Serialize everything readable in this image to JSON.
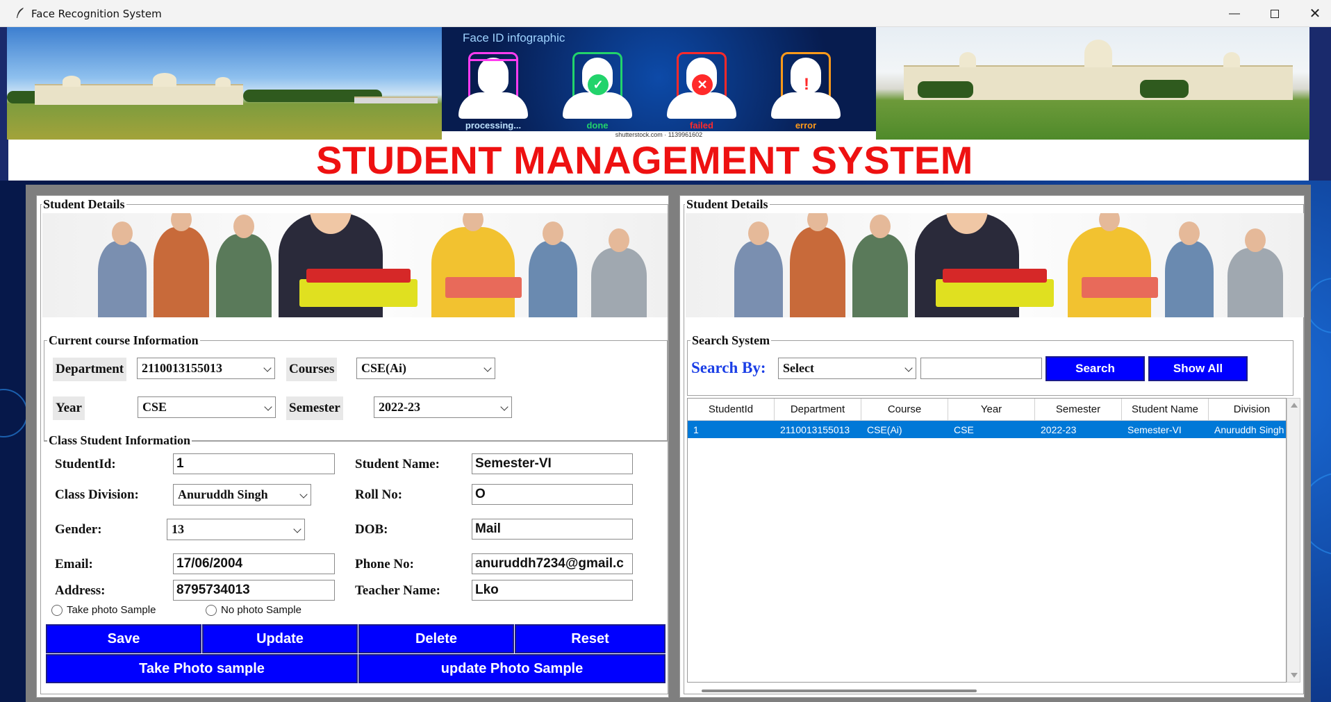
{
  "window": {
    "title": "Face Recognition System",
    "controls": [
      "minimize-icon",
      "maximize-icon",
      "close-icon"
    ]
  },
  "banner": {
    "infographic_title": "Face ID infographic",
    "faces": [
      {
        "caption": "processing...",
        "color": "#ff3cf0",
        "icon": "scan-line-icon"
      },
      {
        "caption": "done",
        "color": "#22d36b",
        "icon": "check-icon"
      },
      {
        "caption": "failed",
        "color": "#ff2a2a",
        "icon": "x-icon"
      },
      {
        "caption": "error",
        "color": "#ff9a1a",
        "icon": "exclamation-icon"
      }
    ],
    "credit": "shutterstock.com · 1139961602"
  },
  "headline": "STUDENT MANAGEMENT SYSTEM",
  "left_panel": {
    "title": "Student Details",
    "course_group": "Current course Information",
    "department_label": "Department",
    "department_value": "2110013155013",
    "courses_label": "Courses",
    "courses_value": "CSE(Ai)",
    "year_label": "Year",
    "year_value": "CSE",
    "semester_label": "Semester",
    "semester_value": "2022-23",
    "class_group": "Class Student Information",
    "studentid_label": "StudentId:",
    "studentid_value": "1",
    "student_name_label": "Student Name:",
    "student_name_value": "Semester-VI",
    "division_label": "Class Division:",
    "division_value": "Anuruddh Singh",
    "roll_label": "Roll No:",
    "roll_value": "O",
    "gender_label": "Gender:",
    "gender_value": "13",
    "dob_label": "DOB:",
    "dob_value": "Mail",
    "email_label": "Email:",
    "email_value": "17/06/2004",
    "phone_label": "Phone No:",
    "phone_value": "anuruddh7234@gmail.c",
    "address_label": "Address:",
    "address_value": "8795734013",
    "teacher_label": "Teacher Name:",
    "teacher_value": "Lko",
    "radio_take": "Take photo Sample",
    "radio_no": "No photo Sample",
    "buttons": {
      "save": "Save",
      "update": "Update",
      "delete": "Delete",
      "reset": "Reset",
      "take_photo": "Take Photo sample",
      "update_photo": "update Photo Sample"
    },
    "button_color": "#0000ff"
  },
  "right_panel": {
    "title": "Student Details",
    "search_group": "Search System",
    "search_by_label": "Search By:",
    "search_by_value": "Select",
    "search_input_value": "",
    "search_button": "Search",
    "show_all_button": "Show All",
    "table": {
      "columns": [
        "StudentId",
        "Department",
        "Course",
        "Year",
        "Semester",
        "Student Name",
        "Division"
      ],
      "rows": [
        [
          "1",
          "2110013155013",
          "CSE(Ai)",
          "CSE",
          "2022-23",
          "Semester-VI",
          "Anuruddh Singh"
        ]
      ],
      "selected_row_color": "#0078d7"
    }
  },
  "colors": {
    "headline": "#ee1111",
    "search_label": "#1a3ee6"
  }
}
